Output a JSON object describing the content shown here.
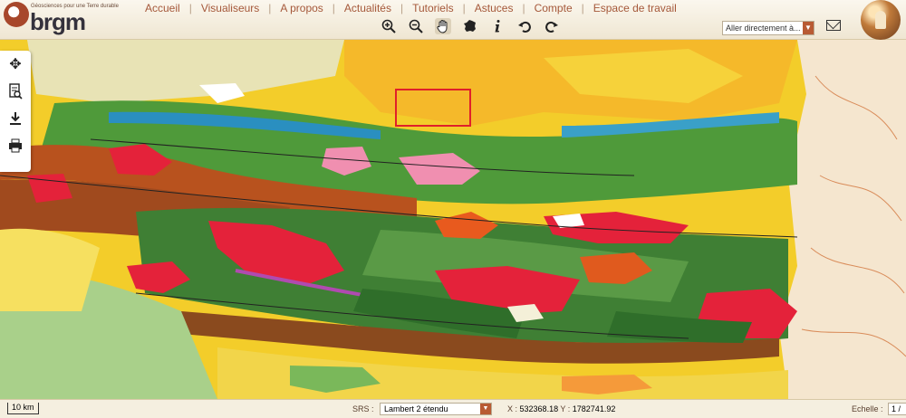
{
  "brand": {
    "name": "brgm",
    "tagline": "Géosciences pour une Terre durable"
  },
  "nav": {
    "items": [
      "Accueil",
      "Visualiseurs",
      "A propos",
      "Actualités",
      "Tutoriels",
      "Astuces",
      "Compte",
      "Espace de travail"
    ]
  },
  "tools": {
    "zoom_in": "zoom-in-icon",
    "zoom_out": "zoom-out-icon",
    "pan": "hand-icon",
    "france": "france-map-icon",
    "info": "info-icon",
    "undo": "undo-icon",
    "redo": "redo-icon"
  },
  "goto": {
    "value": "Aller directement à..."
  },
  "footer": {
    "scale": "10 km",
    "srs_label": "SRS :",
    "srs_value": "Lambert 2 étendu",
    "x_label": "X :",
    "x_value": "532368.18",
    "y_label": "Y :",
    "y_value": "1782741.92",
    "echelle_label": "Echelle :",
    "echelle_value": "1 /"
  },
  "colors": {
    "accent": "#a5583a",
    "selection": "#e0202a"
  }
}
